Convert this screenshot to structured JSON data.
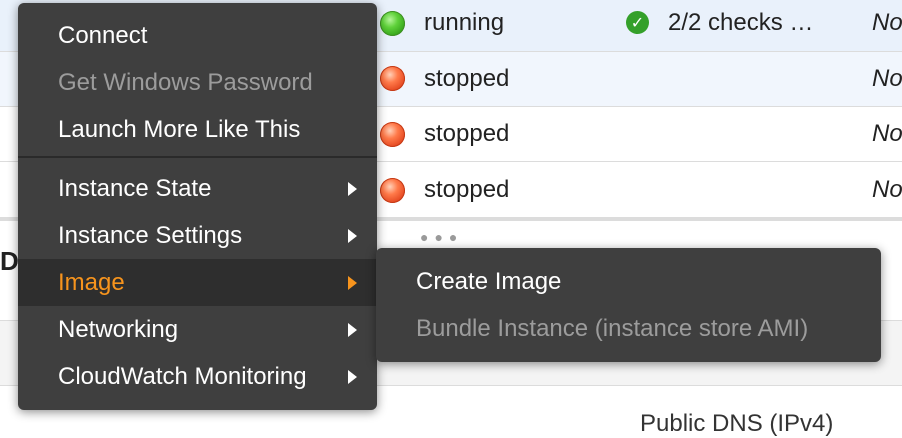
{
  "instances": [
    {
      "state": "running",
      "status_check": "2/2 checks …",
      "monitoring": "No",
      "status_color": "#4cc22a"
    },
    {
      "state": "stopped",
      "status_check": "",
      "monitoring": "No",
      "status_color": "#f05a2a"
    },
    {
      "state": "stopped",
      "status_check": "",
      "monitoring": "No",
      "status_color": "#f05a2a"
    },
    {
      "state": "stopped",
      "status_check": "",
      "monitoring": "No",
      "status_color": "#f05a2a"
    }
  ],
  "details": {
    "heading": "D",
    "public_dns_label": "Public DNS (IPv4)"
  },
  "context_menu": {
    "items": [
      {
        "label": "Connect",
        "disabled": false
      },
      {
        "label": "Get Windows Password",
        "disabled": true
      },
      {
        "label": "Launch More Like This",
        "disabled": false
      },
      {
        "label": "Instance State",
        "submenu": true
      },
      {
        "label": "Instance Settings",
        "submenu": true
      },
      {
        "label": "Image",
        "submenu": true,
        "active": true
      },
      {
        "label": "Networking",
        "submenu": true
      },
      {
        "label": "CloudWatch Monitoring",
        "submenu": true
      }
    ]
  },
  "image_submenu": {
    "items": [
      {
        "label": "Create Image",
        "disabled": false
      },
      {
        "label": "Bundle Instance (instance store AMI)",
        "disabled": true
      }
    ]
  },
  "colors": {
    "menu_bg": "#3f3f3f",
    "active_text": "#f7941d",
    "disabled_text": "#9c9c9c",
    "selected_row": "#e9f1fb"
  },
  "icons": {
    "running": "green-status-dot-icon",
    "stopped": "red-status-dot-icon",
    "check": "check-circle-icon",
    "submenu": "chevron-right-icon"
  }
}
